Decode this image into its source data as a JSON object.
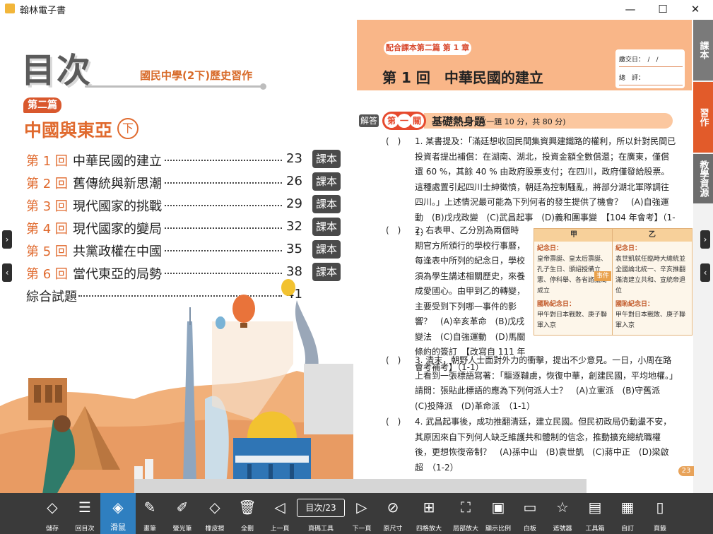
{
  "window": {
    "title": "翰林電子書",
    "minimize": "—",
    "maximize": "☐",
    "close": "✕"
  },
  "left_page": {
    "big_title": "目次",
    "subtitle": "國民中學(2下)歷史習作",
    "part_badge": "第二篇",
    "part_title": "中國與東亞",
    "part_circle": "下",
    "toc": [
      {
        "num": "第 1 回",
        "title": "中華民國的建立",
        "page": "23",
        "book": "課本"
      },
      {
        "num": "第 2 回",
        "title": "舊傳統與新思潮",
        "page": "26",
        "book": "課本"
      },
      {
        "num": "第 3 回",
        "title": "現代國家的挑戰",
        "page": "29",
        "book": "課本"
      },
      {
        "num": "第 4 回",
        "title": "現代國家的變局",
        "page": "32",
        "book": "課本"
      },
      {
        "num": "第 5 回",
        "title": "共黨政權在中國",
        "page": "35",
        "book": "課本"
      },
      {
        "num": "第 6 回",
        "title": "當代東亞的局勢",
        "page": "38",
        "book": "課本"
      }
    ],
    "toc_extra": {
      "title": "綜合試題",
      "page": "41"
    }
  },
  "right_page": {
    "chapter_pill": "配合課本第二篇 第 1 章",
    "lesson_title": "第 1 回　中華民國的建立",
    "info": {
      "date_label": "繳交日：　/　/",
      "comment_label": "總　評："
    },
    "sidebar_tabs": [
      "課本",
      "習作",
      "教學資源"
    ],
    "answer_badge": "解答",
    "level": [
      "第",
      "一",
      "關"
    ],
    "section_title": "基礎熱身題",
    "section_note": "(一題 10 分，共 80 分)",
    "questions": [
      {
        "paren": "(　)",
        "text": "1. 某書提及：「滿廷想收回民間集資興建鐵路的權利，所以針對民間已投資者提出補償：在湖南、湖北，投資金額全數償還；在廣東，僅償還 60 %，其餘 40 % 由政府股票支付；在四川，政府僅發給股票。這種處置引起四川士紳徵憤，朝廷為控制騷亂，將部分湖北軍隊調往四川。」上述情況最可能為下列何者的發生提供了機會？　(A)自強運動　(B)戊戌政變　(C)武昌起事　(D)義和團事變　【104 年會考】（1-1）"
      },
      {
        "paren": "(　)",
        "text": "2. 右表甲、乙分別為兩個時期官方所頒行的學校行事曆，每逢表中所列的紀念日，學校須為學生講述相關歷史，來養成愛國心。由甲到乙的轉變，主要受到下列哪一事件的影響？　(A)辛亥革命　(B)戊戌變法　(C)自強運動　(D)馬關條約的簽訂　【改寫自 111 年會考補考】（1-1）"
      },
      {
        "paren": "(　)",
        "text": "3. 清末，朝野人士面對外力的衝擊，提出不少意見。一日，小周在路上看到一張標語寫著：「驅逐韃虜，恢復中華，創建民國，平均地權。」請問：張貼此標語的應為下列何派人士？　(A)立憲派　(B)守舊派　(C)投降派　(D)革命派　（1-1）"
      },
      {
        "paren": "(　)",
        "text": "4. 武昌起事後，成功推翻清廷，建立民國。但民初政局仍動盪不安，其原因來自下列何人缺乏維護共和體制的信念，推動擴充總統職權後，更想恢復帝制？　(A)孫中山　(B)袁世凱　(C)蔣中正　(D)梁啟超　（1-2）"
      }
    ],
    "figure": {
      "jia": {
        "head": "甲",
        "label1": "紀念日：",
        "body1": "皇帝壽誕、皇太后壽誕、孔子生日、頒詔授備立憲、停科舉、各省諮議局成立",
        "label2": "國恥紀念日：",
        "body2": "甲午對日本戰敗、庚子聯軍入京"
      },
      "yi": {
        "head": "乙",
        "label1": "紀念日：",
        "body1": "袁世凱就任臨時大總統並全國論北統一、辛亥推翻滿清建立共和、宣統帝退位",
        "label2": "國恥紀念日：",
        "body2": "甲午對日本戰敗、庚子聯軍入京"
      },
      "arrow": "事件"
    },
    "page_number": "23"
  },
  "toolbar": {
    "page_box": "目次/23",
    "items": [
      {
        "label": "儲存",
        "icon": "◇"
      },
      {
        "label": "回目次",
        "icon": "☰"
      },
      {
        "label": "滑鼠",
        "icon": "◈"
      },
      {
        "label": "畫筆",
        "icon": "✎"
      },
      {
        "label": "螢光筆",
        "icon": "✐"
      },
      {
        "label": "橡皮擦",
        "icon": "◇"
      },
      {
        "label": "全刪",
        "icon": "🗑"
      },
      {
        "label": "上一頁",
        "icon": "◁"
      },
      {
        "label": "頁碼工具",
        "icon": ""
      },
      {
        "label": "下一頁",
        "icon": "▷"
      },
      {
        "label": "原尺寸",
        "icon": "⊘"
      },
      {
        "label": "四格放大",
        "icon": "⊞"
      },
      {
        "label": "局部放大",
        "icon": "⛶"
      },
      {
        "label": "顯示比例",
        "icon": "▣"
      },
      {
        "label": "白板",
        "icon": "▭"
      },
      {
        "label": "遮號器",
        "icon": "☆"
      },
      {
        "label": "工具箱",
        "icon": "▤"
      },
      {
        "label": "自訂",
        "icon": "▦"
      },
      {
        "label": "頁籤",
        "icon": "▯"
      }
    ]
  },
  "colors": {
    "accent": "#e06a2e",
    "toolbar_bg": "#3a3a3a",
    "selected": "#2f7fc0",
    "header_peach": "#f9b688"
  }
}
